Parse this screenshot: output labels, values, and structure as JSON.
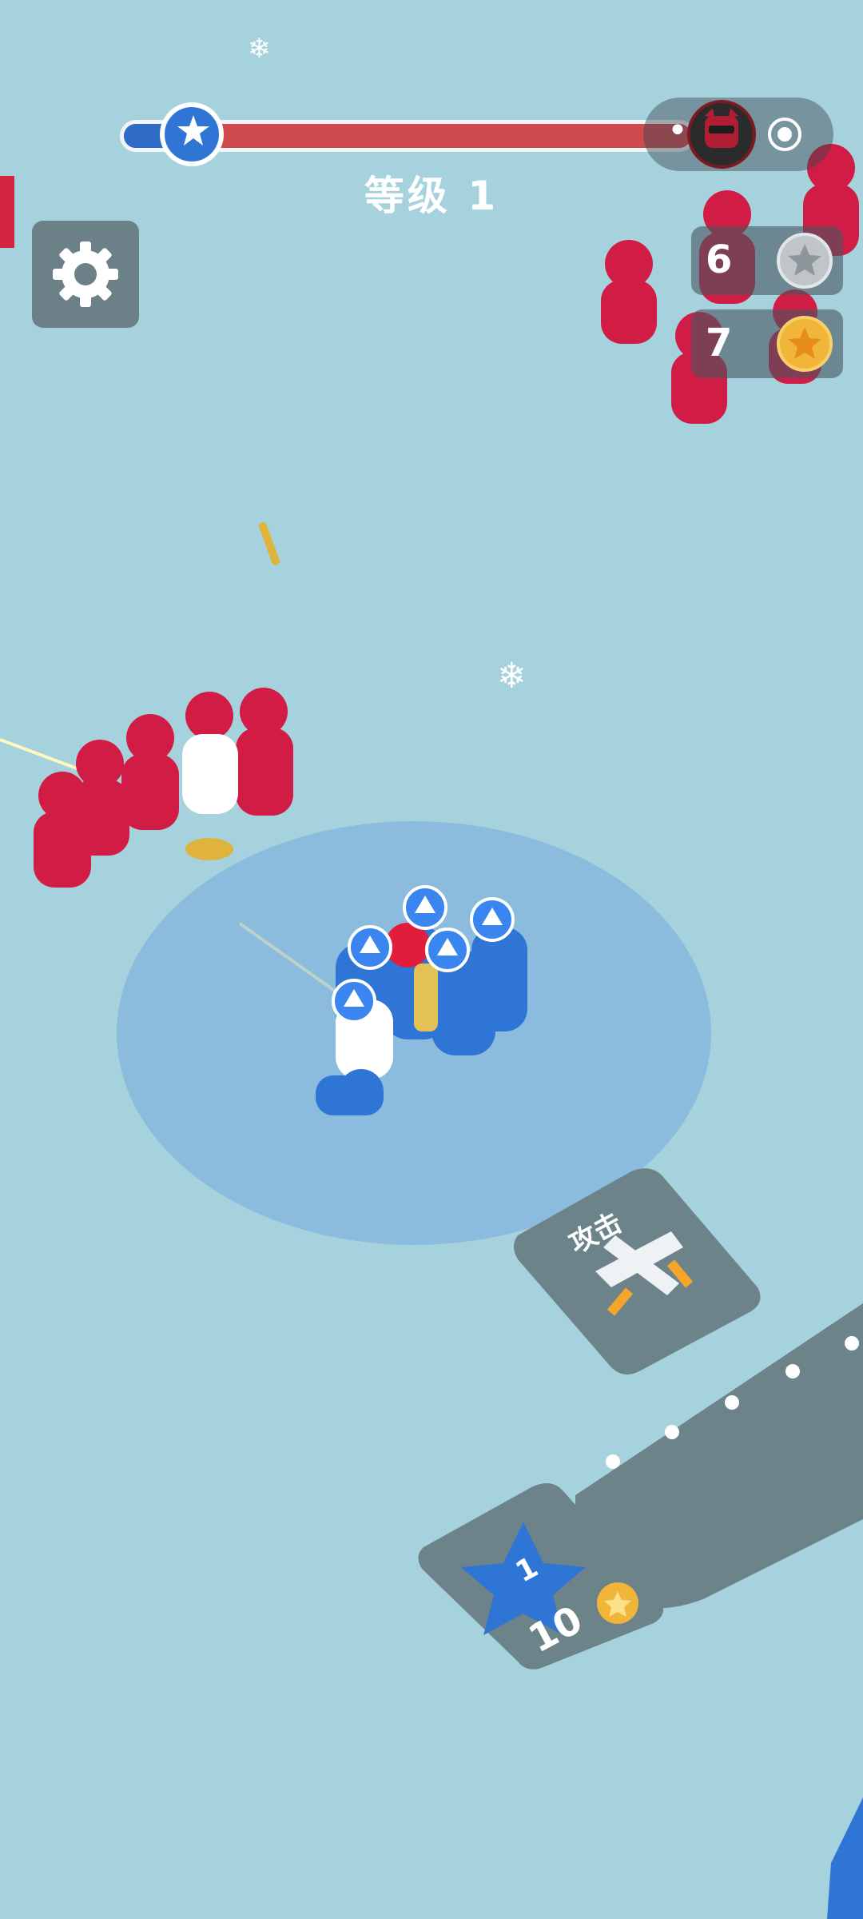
{
  "hud": {
    "level_label": "等级",
    "level_number": "1",
    "progress_fraction": 0.1
  },
  "counters": [
    {
      "value": "6",
      "coin_type": "silver-star-coin"
    },
    {
      "value": "7",
      "coin_type": "gold-star-coin"
    }
  ],
  "capsule": {
    "more_icon": "•••",
    "close_icon": "target-icon"
  },
  "tiles": {
    "attack_label": "攻击",
    "upgrade_level": "1",
    "upgrade_cost": "10"
  },
  "colors": {
    "player_blue": "#2f75d6",
    "enemy_red": "#d11c45",
    "progress_red": "#cf4a4f",
    "ground": "#a6d2de"
  }
}
